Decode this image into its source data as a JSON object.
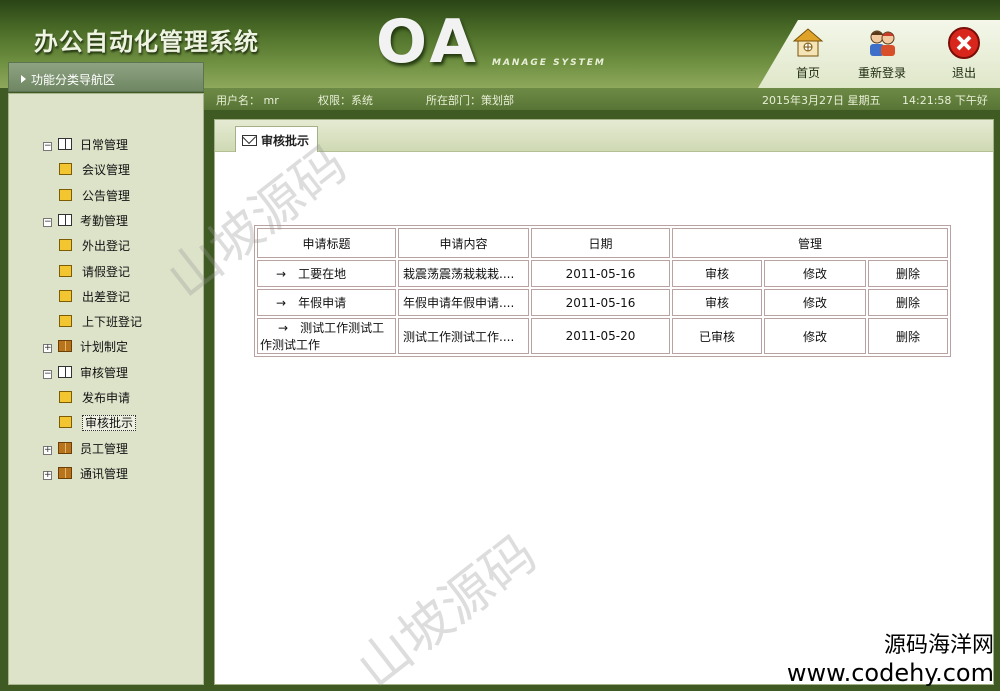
{
  "header": {
    "system_title": "办公自动化管理系统",
    "logo": "OA",
    "logo_sub": "MANAGE SYSTEM"
  },
  "toolbar": {
    "home_label": "首页",
    "relogin_label": "重新登录",
    "logout_label": "退出"
  },
  "nav_title": "功能分类导航区",
  "info_bar": {
    "user": "用户名： mr",
    "role": "权限：系统",
    "department": "所在部门：策划部",
    "date": "2015年3月27日 星期五",
    "time": "14:21:58 下午好"
  },
  "sidebar": {
    "groups": [
      {
        "label": "日常管理",
        "expanded": true,
        "children": [
          "会议管理",
          "公告管理"
        ]
      },
      {
        "label": "考勤管理",
        "expanded": true,
        "children": [
          "外出登记",
          "请假登记",
          "出差登记",
          "上下班登记"
        ]
      },
      {
        "label": "计划制定",
        "expanded": false,
        "children": []
      },
      {
        "label": "审核管理",
        "expanded": true,
        "children": [
          "发布申请",
          "审核批示"
        ]
      },
      {
        "label": "员工管理",
        "expanded": false,
        "children": []
      },
      {
        "label": "通讯管理",
        "expanded": false,
        "children": []
      }
    ],
    "selected": "审核批示"
  },
  "main": {
    "tab_label": "审核批示",
    "table": {
      "headers": [
        "申请标题",
        "申请内容",
        "日期",
        "管理"
      ],
      "rows": [
        {
          "arrow": "→",
          "title": "工要在地",
          "content": "栽震荡震荡栽栽栽....",
          "date": "2011-05-16",
          "status": "审核",
          "edit": "修改",
          "delete": "删除"
        },
        {
          "arrow": "→",
          "title": "年假申请",
          "content": "年假申请年假申请....",
          "date": "2011-05-16",
          "status": "审核",
          "edit": "修改",
          "delete": "删除"
        },
        {
          "arrow": "→",
          "title": "测试工作测试工作测试工作",
          "content": "测试工作测试工作....",
          "date": "2011-05-20",
          "status": "已审核",
          "edit": "修改",
          "delete": "删除"
        }
      ]
    }
  },
  "watermark": "山坡源码",
  "brand": {
    "line1": "源码海洋网",
    "line2": "www.codehy.com"
  },
  "colors": {
    "header_dark": "#2a4416",
    "header_light": "#8ea85c",
    "sidebar_bg": "#dde3c9",
    "panel_border": "#a4b086",
    "table_border": "#b9a2a2"
  }
}
